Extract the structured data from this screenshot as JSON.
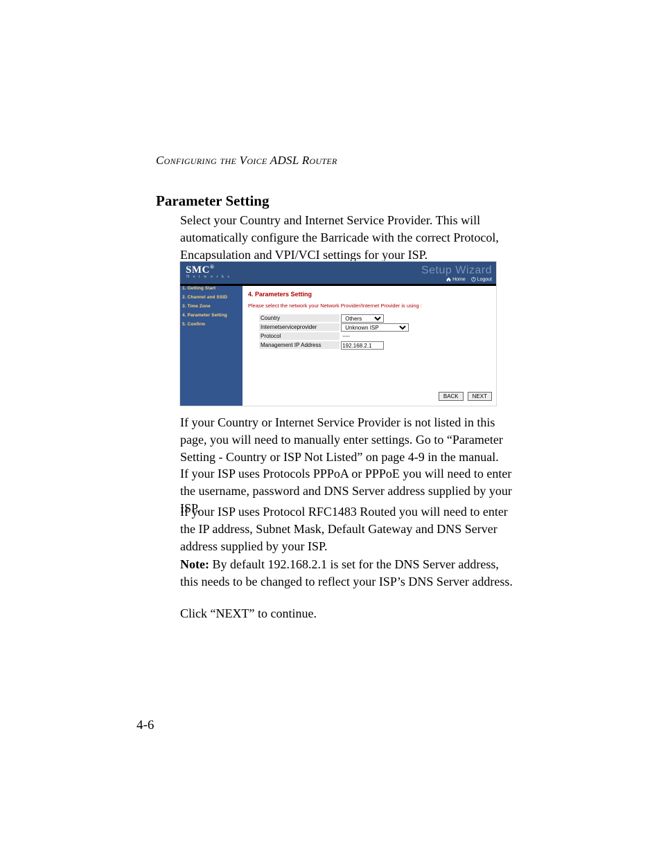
{
  "running_head": "Configuring the Voice ADSL Router",
  "heading": "Parameter Setting",
  "para1": "Select your Country and Internet Service Provider. This will automatically configure the Barricade with the correct Protocol, Encapsulation and VPI/VCI settings for your ISP.",
  "para2": "If your Country or Internet Service Provider is not listed in this page, you will need to manually enter settings. Go to “Parameter Setting - Country or ISP Not Listed” on page 4-9 in the manual.",
  "para3": "If your ISP uses Protocols PPPoA or PPPoE you will need to enter the username, password and DNS Server address supplied by your ISP.",
  "para4": "If your ISP uses Protocol RFC1483 Routed you will need to enter the IP address, Subnet Mask, Default Gateway and DNS Server address supplied by your ISP.",
  "note_label": "Note:",
  "note_body": "By default 192.168.2.1 is set for the DNS Server address, this needs to be changed to reflect your ISP’s DNS Server address.",
  "para5": "Click “NEXT” to continue.",
  "page_number": "4-6",
  "screenshot": {
    "logo": "SMC",
    "logo_reg": "®",
    "logo_sub": "N e t w o r k s",
    "wizard_title": "Setup Wizard",
    "home": "Home",
    "logout": "Logout",
    "sidebar": {
      "items": [
        {
          "label": "1. Getting Start"
        },
        {
          "label": "2. Channel and SSID"
        },
        {
          "label": "3. Time Zone"
        },
        {
          "label": "4. Parameter Setting"
        },
        {
          "label": "5. Confirm"
        }
      ]
    },
    "panel_title": "4. Parameters Setting",
    "panel_sub": "Please select the network your Network Provider/Internet Provider is using :",
    "form": {
      "country_label": "Country",
      "country_value": "Others",
      "isp_label": "Internetserviceprovider",
      "isp_value": "Unknown ISP",
      "protocol_label": "Protocol",
      "protocol_value": "----",
      "mgmt_label": "Management IP Address",
      "mgmt_value": "192.168.2.1"
    },
    "buttons": {
      "back": "BACK",
      "next": "NEXT"
    }
  }
}
